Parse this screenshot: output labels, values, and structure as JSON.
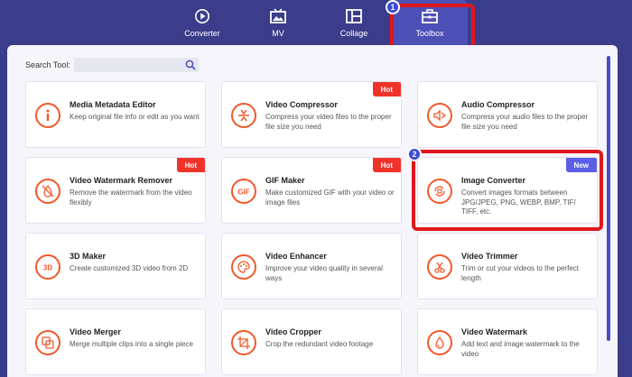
{
  "nav": {
    "tabs": [
      {
        "label": "Converter"
      },
      {
        "label": "MV"
      },
      {
        "label": "Collage"
      },
      {
        "label": "Toolbox",
        "active": true
      }
    ]
  },
  "search": {
    "label": "Search Tool:",
    "value": "",
    "placeholder": ""
  },
  "annotations": [
    {
      "number": "1"
    },
    {
      "number": "2"
    }
  ],
  "tools": [
    {
      "title": "Media Metadata Editor",
      "desc": "Keep original file info or edit as you want",
      "icon": "info-icon",
      "badge": ""
    },
    {
      "title": "Video Compressor",
      "desc": "Compress your video files to the proper file size you need",
      "icon": "compress-icon",
      "badge": "Hot"
    },
    {
      "title": "Audio Compressor",
      "desc": "Compress your audio files to the proper file size you need",
      "icon": "audio-compress-icon",
      "badge": ""
    },
    {
      "title": "Video Watermark Remover",
      "desc": "Remove the watermark from the video flexibly",
      "icon": "watermark-remove-icon",
      "badge": "Hot"
    },
    {
      "title": "GIF Maker",
      "desc": "Make customized GIF with your video or image files",
      "icon": "gif-icon",
      "badge": "Hot"
    },
    {
      "title": "Image Converter",
      "desc": "Convert images formats between JPG/JPEG, PNG, WEBP, BMP, TIF/ TIFF, etc.",
      "icon": "image-convert-icon",
      "badge": "New"
    },
    {
      "title": "3D Maker",
      "desc": "Create customized 3D video from 2D",
      "icon": "3d-icon",
      "badge": ""
    },
    {
      "title": "Video Enhancer",
      "desc": "Improve your video quality in several ways",
      "icon": "palette-icon",
      "badge": ""
    },
    {
      "title": "Video Trimmer",
      "desc": "Trim or cut your videos to the perfect length",
      "icon": "scissors-icon",
      "badge": ""
    },
    {
      "title": "Video Merger",
      "desc": "Merge multiple clips into a single piece",
      "icon": "merge-icon",
      "badge": ""
    },
    {
      "title": "Video Cropper",
      "desc": "Crop the redundant video footage",
      "icon": "crop-icon",
      "badge": ""
    },
    {
      "title": "Video Watermark",
      "desc": "Add text and image watermark to the video",
      "icon": "watermark-icon",
      "badge": ""
    }
  ],
  "colors": {
    "background": "#3b3d8a",
    "active_tab": "#4d50b7",
    "accent": "#f0592b",
    "hot": "#f0332a",
    "new": "#5c5ee6",
    "annotation": "#e0171c"
  }
}
